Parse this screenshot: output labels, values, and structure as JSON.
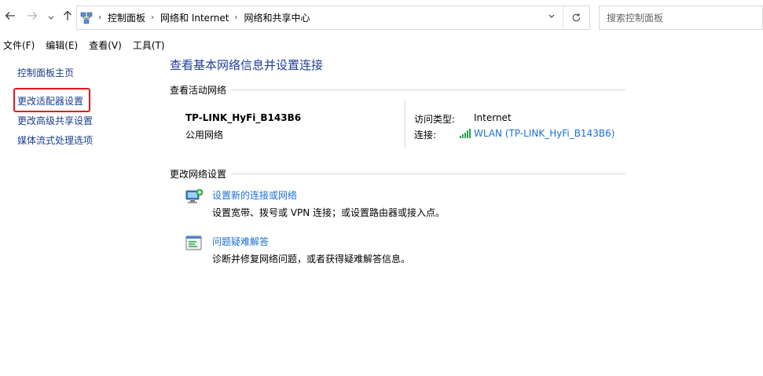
{
  "address_bar": {
    "nav_back_icon": "arrow-left-icon",
    "nav_forward_icon": "arrow-right-icon",
    "recent_icon": "chevron-down-icon",
    "up_icon": "arrow-up-icon",
    "location_icon": "network-icon",
    "breadcrumbs": [
      "控制面板",
      "网络和 Internet",
      "网络和共享中心"
    ],
    "dropdown_icon": "chevron-down-icon",
    "refresh_icon": "refresh-icon"
  },
  "search": {
    "placeholder": "搜索控制面板"
  },
  "menu": {
    "items": [
      "文件(F)",
      "编辑(E)",
      "查看(V)",
      "工具(T)"
    ]
  },
  "left_nav": {
    "items": [
      "控制面板主页",
      "更改适配器设置",
      "更改高级共享设置",
      "媒体流式处理选项"
    ],
    "highlight_color": "#e8151b"
  },
  "main": {
    "title": "查看基本网络信息并设置连接",
    "active_networks_header": "查看活动网络",
    "network": {
      "name": "TP-LINK_HyFi_B143B6",
      "type": "公用网络",
      "access_type_label": "访问类型:",
      "access_type_value": "Internet",
      "connection_label": "连接:",
      "connection_value": "WLAN (TP-LINK_HyFi_B143B6)",
      "connection_icon": "wifi-signal-icon"
    },
    "change_settings_header": "更改网络设置",
    "tasks": [
      {
        "icon": "network-setup-icon",
        "link": "设置新的连接或网络",
        "desc": "设置宽带、拨号或 VPN 连接；或设置路由器或接入点。"
      },
      {
        "icon": "troubleshoot-icon",
        "link": "问题疑难解答",
        "desc": "诊断并修复网络问题，或者获得疑难解答信息。"
      }
    ]
  },
  "colors": {
    "title": "#1e3f9a",
    "link": "#1a6fd6",
    "nav_link": "#1a3f8a"
  }
}
